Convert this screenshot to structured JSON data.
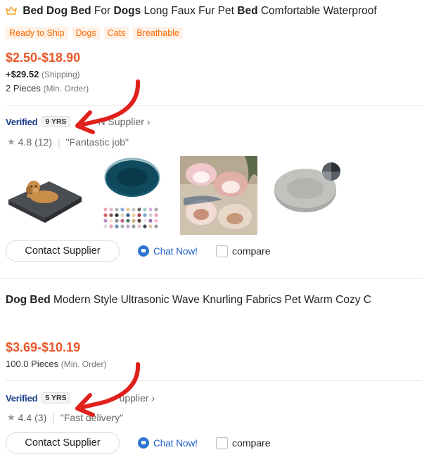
{
  "listings": [
    {
      "title_parts": [
        {
          "text": "Bed Dog Bed",
          "bold": true
        },
        {
          "text": " For ",
          "bold": false
        },
        {
          "text": "Dogs",
          "bold": true
        },
        {
          "text": " Long Faux Fur Pet ",
          "bold": false
        },
        {
          "text": "Bed",
          "bold": true
        },
        {
          "text": " Comfortable Waterproof",
          "bold": false
        }
      ],
      "tags": [
        "Ready to Ship",
        "Dogs",
        "Cats",
        "Breathable"
      ],
      "price": "$2.50-$18.90",
      "shipping_amount": "+$29.52",
      "shipping_label": "(Shipping)",
      "moq_value": "2 Pieces",
      "moq_label": "(Min. Order)",
      "verified": "Verified",
      "years": "9 YRS",
      "supplier_text": "N Supplier",
      "rating_value": "4.8",
      "rating_count": "(12)",
      "review": "\"Fantastic job\"",
      "contact_label": "Contact Supplier",
      "chat_label": "Chat Now!",
      "compare_label": "compare"
    },
    {
      "title_parts": [
        {
          "text": "Dog Bed",
          "bold": true
        },
        {
          "text": " Modern Style Ultrasonic Wave Knurling Fabrics Pet Warm Cozy C",
          "bold": false
        }
      ],
      "price": "$3.69-$10.19",
      "moq_value": "100.0 Pieces",
      "moq_label": "(Min. Order)",
      "verified": "Verified",
      "years": "5 YRS",
      "supplier_text": "upplier",
      "rating_value": "4.4",
      "rating_count": "(3)",
      "review": "\"Fast delivery\"",
      "contact_label": "Contact Supplier",
      "chat_label": "Chat Now!",
      "compare_label": "compare"
    }
  ],
  "thumbnails": [
    "dog-on-gray-mattress-bed",
    "teal-donut-bed-with-color-swatches",
    "fluffy-cave-beds",
    "gray-round-plush-bed"
  ],
  "colors": {
    "accent_orange": "#e8582a",
    "tag_orange": "#ff6a00",
    "annotation_red": "#e0201a",
    "verified_blue": "#1a3e8a",
    "chat_blue": "#1d5fc9"
  }
}
